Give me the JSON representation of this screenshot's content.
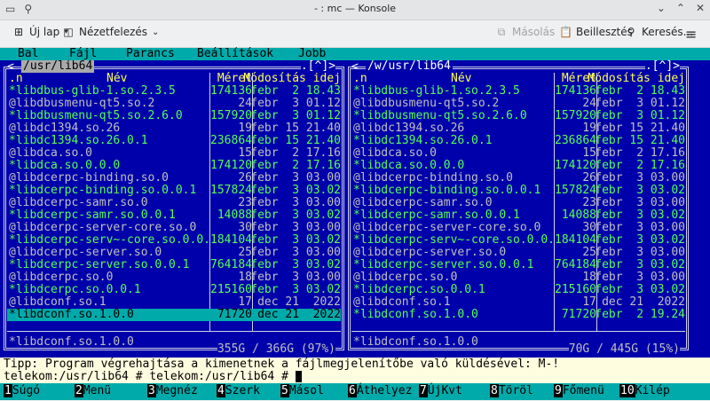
{
  "window": {
    "title": "- : mc — Konsole"
  },
  "toolbar": {
    "new_tab": "Új lap",
    "split": "Nézetfelezés",
    "copy": "Másolás",
    "paste": "Beillesztés",
    "search": "Keresés..."
  },
  "menu": {
    "items": [
      "Bal",
      "Fájl",
      "Parancs",
      "Beállítások",
      "Jobb"
    ]
  },
  "left_panel": {
    "path": " /usr/lib64 ",
    "corner": ".[^]>",
    "header": {
      "name": ".n",
      "title": "Név",
      "size": "Méret",
      "date": "Módosítás idej"
    },
    "files": [
      {
        "name": "*libdbus-glib-1.so.2.3.5",
        "size": "174136",
        "date": "febr  2 18.43",
        "color": "green"
      },
      {
        "name": "@libdbusmenu-qt5.so.2",
        "size": "24",
        "date": "febr  3 01.12",
        "color": "grey"
      },
      {
        "name": "*libdbusmenu-qt5.so.2.6.0",
        "size": "157920",
        "date": "febr  3 01.12",
        "color": "green"
      },
      {
        "name": "@libdc1394.so.26",
        "size": "19",
        "date": "febr 15 21.40",
        "color": "grey"
      },
      {
        "name": "*libdc1394.so.26.0.1",
        "size": "236864",
        "date": "febr 15 21.40",
        "color": "green"
      },
      {
        "name": "@libdca.so.0",
        "size": "15",
        "date": "febr  2 17.16",
        "color": "grey"
      },
      {
        "name": "*libdca.so.0.0.0",
        "size": "174120",
        "date": "febr  2 17.16",
        "color": "green"
      },
      {
        "name": "@libdcerpc-binding.so.0",
        "size": "26",
        "date": "febr  3 03.00",
        "color": "grey"
      },
      {
        "name": "*libdcerpc-binding.so.0.0.1",
        "size": "157824",
        "date": "febr  3 03.02",
        "color": "green"
      },
      {
        "name": "@libdcerpc-samr.so.0",
        "size": "23",
        "date": "febr  3 03.00",
        "color": "grey"
      },
      {
        "name": "*libdcerpc-samr.so.0.0.1",
        "size": "14088",
        "date": "febr  3 03.02",
        "color": "green"
      },
      {
        "name": "@libdcerpc-server-core.so.0",
        "size": "30",
        "date": "febr  3 03.00",
        "color": "grey"
      },
      {
        "name": "*libdcerpc-serv~-core.so.0.0.1",
        "size": "84104",
        "date": "febr  3 03.02",
        "color": "green"
      },
      {
        "name": "@libdcerpc-server.so.0",
        "size": "25",
        "date": "febr  3 03.00",
        "color": "grey"
      },
      {
        "name": "*libdcerpc-server.so.0.0.1",
        "size": "764184",
        "date": "febr  3 03.02",
        "color": "green"
      },
      {
        "name": "@libdcerpc.so.0",
        "size": "18",
        "date": "febr  3 03.00",
        "color": "grey"
      },
      {
        "name": "*libdcerpc.so.0.0.1",
        "size": "215160",
        "date": "febr  3 03.02",
        "color": "green"
      },
      {
        "name": "@libdconf.so.1",
        "size": "17",
        "date": " dec 21  2022",
        "color": "grey"
      },
      {
        "name": "*libdconf.so.1.0.0",
        "size": "71720",
        "date": " dec 21  2022",
        "color": "sel"
      }
    ],
    "mini_status": "*libdconf.so.1.0.0",
    "free": "355G / 366G (97%)"
  },
  "right_panel": {
    "path": " /w/usr/lib64 ",
    "corner": ".[^]>",
    "header": {
      "name": ".n",
      "title": "Név",
      "size": "Méret",
      "date": "Módosítás idej"
    },
    "files": [
      {
        "name": "*libdbus-glib-1.so.2.3.5",
        "size": "174136",
        "date": "febr  2 18.43",
        "color": "green"
      },
      {
        "name": "@libdbusmenu-qt5.so.2",
        "size": "24",
        "date": "febr  3 01.12",
        "color": "grey"
      },
      {
        "name": "*libdbusmenu-qt5.so.2.6.0",
        "size": "157920",
        "date": "febr  3 01.12",
        "color": "green"
      },
      {
        "name": "@libdc1394.so.26",
        "size": "19",
        "date": "febr 15 21.40",
        "color": "grey"
      },
      {
        "name": "*libdc1394.so.26.0.1",
        "size": "236864",
        "date": "febr 15 21.40",
        "color": "green"
      },
      {
        "name": "@libdca.so.0",
        "size": "15",
        "date": "febr  2 17.16",
        "color": "grey"
      },
      {
        "name": "*libdca.so.0.0.0",
        "size": "174120",
        "date": "febr  2 17.16",
        "color": "green"
      },
      {
        "name": "@libdcerpc-binding.so.0",
        "size": "26",
        "date": "febr  3 03.00",
        "color": "grey"
      },
      {
        "name": "*libdcerpc-binding.so.0.0.1",
        "size": "157824",
        "date": "febr  3 03.02",
        "color": "green"
      },
      {
        "name": "@libdcerpc-samr.so.0",
        "size": "23",
        "date": "febr  3 03.00",
        "color": "grey"
      },
      {
        "name": "*libdcerpc-samr.so.0.0.1",
        "size": "14088",
        "date": "febr  3 03.02",
        "color": "green"
      },
      {
        "name": "@libdcerpc-server-core.so.0",
        "size": "30",
        "date": "febr  3 03.00",
        "color": "grey"
      },
      {
        "name": "*libdcerpc-serv~-core.so.0.0.1",
        "size": "84104",
        "date": "febr  3 03.02",
        "color": "green"
      },
      {
        "name": "@libdcerpc-server.so.0",
        "size": "25",
        "date": "febr  3 03.00",
        "color": "grey"
      },
      {
        "name": "*libdcerpc-server.so.0.0.1",
        "size": "764184",
        "date": "febr  3 03.02",
        "color": "green"
      },
      {
        "name": "@libdcerpc.so.0",
        "size": "18",
        "date": "febr  3 03.00",
        "color": "grey"
      },
      {
        "name": "*libdcerpc.so.0.0.1",
        "size": "215160",
        "date": "febr  3 03.02",
        "color": "green"
      },
      {
        "name": "@libdconf.so.1",
        "size": "17",
        "date": " dec 21  2022",
        "color": "grey"
      },
      {
        "name": "*libdconf.so.1.0.0",
        "size": "71720",
        "date": "febr  2 19.24",
        "color": "green"
      }
    ],
    "mini_status": "*libdconf.so.1.0.0",
    "free": "70G / 445G (15%)"
  },
  "hint": "Tipp: Program végrehajtása a kimenetnek a fájlmegjelenítőbe való küldésével: M-!",
  "prompt_prev": "telekom:/usr/lib64 # telekom:/usr/lib64 # ",
  "fkeys": [
    {
      "num": "1",
      "label": "Súgó"
    },
    {
      "num": "2",
      "label": "Menü"
    },
    {
      "num": "3",
      "label": "Megnéz"
    },
    {
      "num": "4",
      "label": "Szerk"
    },
    {
      "num": "5",
      "label": "Másol"
    },
    {
      "num": "6",
      "label": "Áthelyez"
    },
    {
      "num": "7",
      "label": "ÚjKvt"
    },
    {
      "num": "8",
      "label": "Töröl"
    },
    {
      "num": "9",
      "label": "Főmenü"
    },
    {
      "num": "10",
      "label": "Kilép"
    }
  ]
}
